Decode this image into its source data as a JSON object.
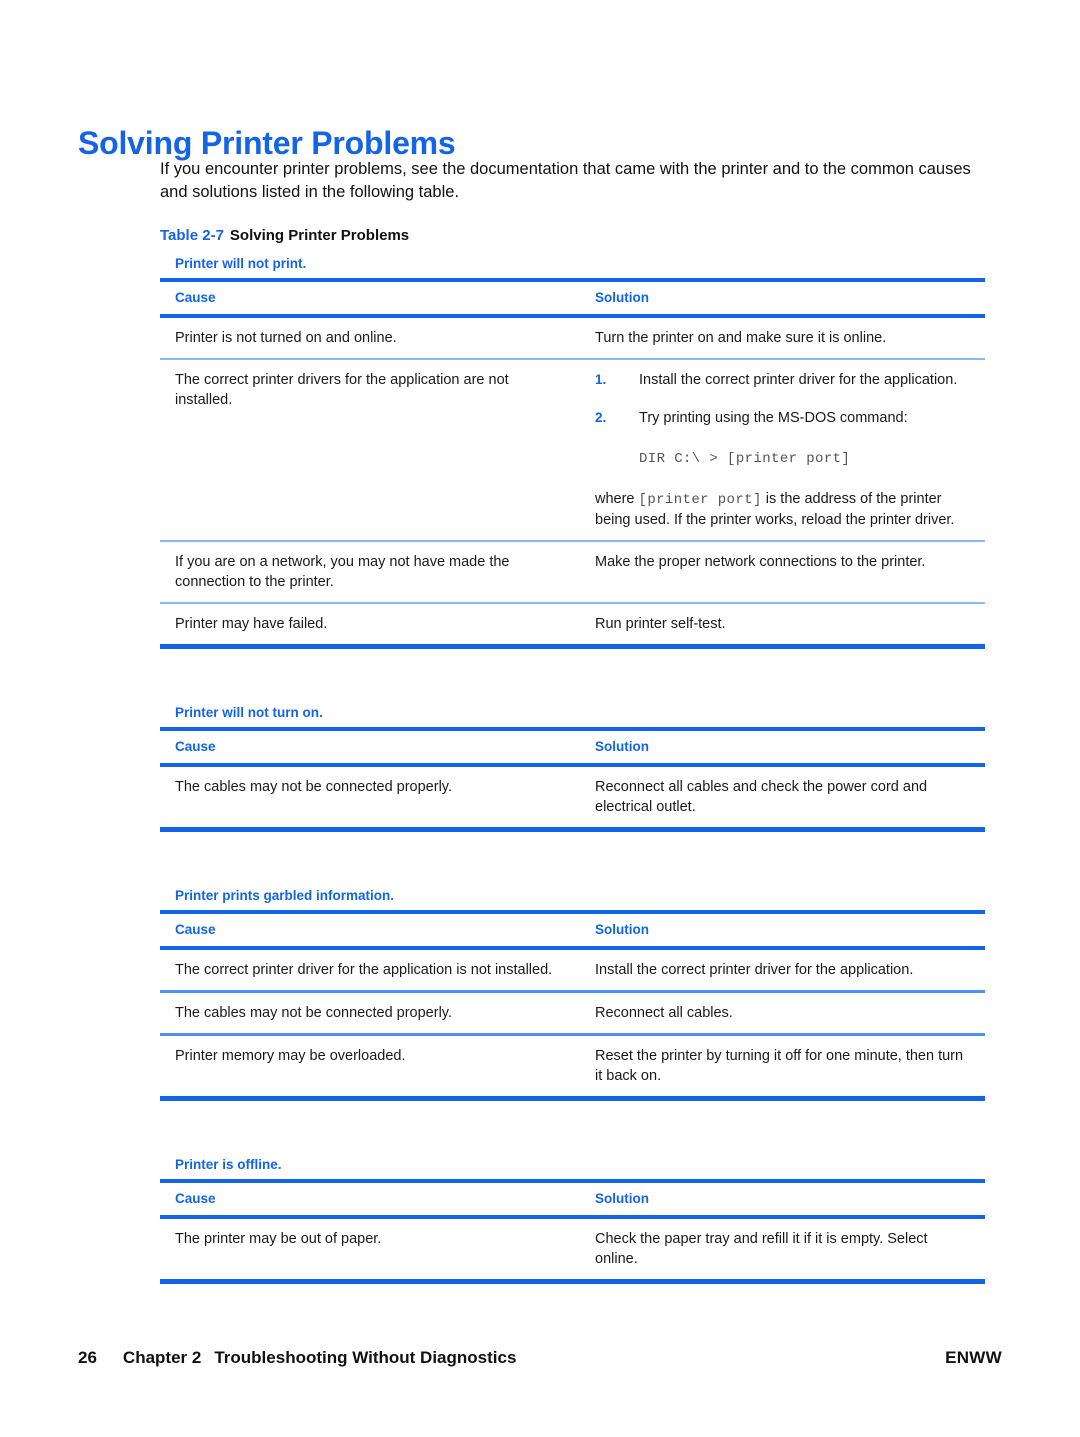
{
  "page": {
    "title": "Solving Printer Problems",
    "intro": "If you encounter printer problems, see the documentation that came with the printer and to the common causes and solutions listed in the following table.",
    "accent_color": "#1464E6",
    "rule_light_color": "#88B8F2",
    "text_color": "#1a1a1a"
  },
  "table_caption": {
    "label": "Table 2-7",
    "title": "Solving Printer Problems"
  },
  "columns": {
    "cause": "Cause",
    "solution": "Solution"
  },
  "sections": [
    {
      "title": "Printer will not print.",
      "rows": [
        {
          "cause": "Printer is not turned on and online.",
          "solution": "Turn the printer on and make sure it is online."
        },
        {
          "cause": "The correct printer drivers for the application are not installed.",
          "steps": [
            {
              "num": "1.",
              "text": "Install the correct printer driver for the application."
            },
            {
              "num": "2.",
              "text": "Try printing using the MS-DOS command:"
            }
          ],
          "command": "DIR C:\\ > [printer port]",
          "note_pre": "where ",
          "note_mono": "[printer port]",
          "note_post": " is the address of the printer being used. If the printer works, reload the printer driver."
        },
        {
          "cause": "If you are on a network, you may not have made the connection to the printer.",
          "solution": "Make the proper network connections to the printer."
        },
        {
          "cause": "Printer may have failed.",
          "solution": "Run printer self-test."
        }
      ]
    },
    {
      "title": "Printer will not turn on.",
      "rows": [
        {
          "cause": "The cables may not be connected properly.",
          "solution": "Reconnect all cables and check the power cord and electrical outlet."
        }
      ]
    },
    {
      "title": "Printer prints garbled information.",
      "rows": [
        {
          "cause": "The correct printer driver for the application is not installed.",
          "solution": "Install the correct printer driver for the application."
        },
        {
          "cause": "The cables may not be connected properly.",
          "solution": "Reconnect all cables."
        },
        {
          "cause": "Printer memory may be overloaded.",
          "solution": "Reset the printer by turning it off for one minute, then turn it back on."
        }
      ]
    },
    {
      "title": "Printer is offline.",
      "rows": [
        {
          "cause": "The printer may be out of paper.",
          "solution": "Check the paper tray and refill it if it is empty. Select online."
        }
      ]
    }
  ],
  "footer": {
    "page_number": "26",
    "chapter": "Chapter 2",
    "chapter_title": "Troubleshooting Without Diagnostics",
    "right": "ENWW"
  }
}
